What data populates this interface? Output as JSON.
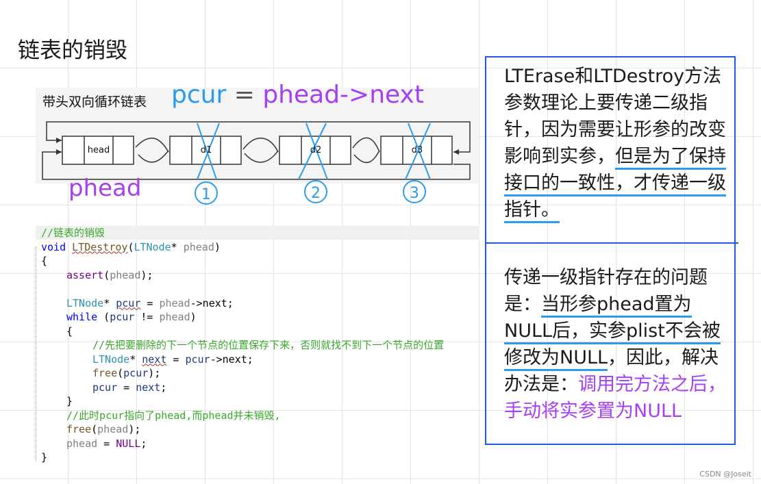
{
  "title": "链表的销毁",
  "diagram": {
    "label": "带头双向循环链表",
    "pcur_var": "pcur",
    "eq": " = ",
    "pcur_value": "phead->next",
    "phead_label": "phead",
    "nodes": [
      "head",
      "d1",
      "d2",
      "d3"
    ],
    "step_numbers": [
      "1",
      "2",
      "3"
    ]
  },
  "code": {
    "comment_title": "//链表的销毁",
    "kw_void": "void",
    "fn_destroy": "LTDestroy",
    "paren_open": "(",
    "type_ltnode": "LTNode",
    "star": "*",
    "param_phead": "phead",
    "paren_close": ")",
    "brace_open": "{",
    "brace_close": "}",
    "fn_assert": "assert",
    "kw_while": "while",
    "var_pcur": "pcur",
    "var_next": "next",
    "var_phead": "phead",
    "arrow_next": "->next;",
    "assign": " = ",
    "neq": " != ",
    "semi_paren": ");",
    "comment_save": "//先把要删除的下一个节点的位置保存下来，否则就找不到下一个节点的位置",
    "fn_free": "free",
    "comment_after": "//此时pcur指向了phead,而phead并未销毁,",
    "macro_null": "NULL",
    "semi": ";"
  },
  "notes": {
    "note1_a": "LTErase和LTDestroy方法参数理论上要传递二级指针，因为需要让形参的改变影响到实参，",
    "note1_b": "但是为了保持接口的一致性，才传递一级指针。",
    "note2_a": "传递一级指针存在的问题是：",
    "note2_b": "当形参phead置为NULL后，实参plist不会被修改为NULL",
    "note2_c": "，因此，解决办法是：",
    "note2_d": "调用完方法之后，手动将实参置为NULL"
  },
  "footer": "CSDN @Joseit"
}
